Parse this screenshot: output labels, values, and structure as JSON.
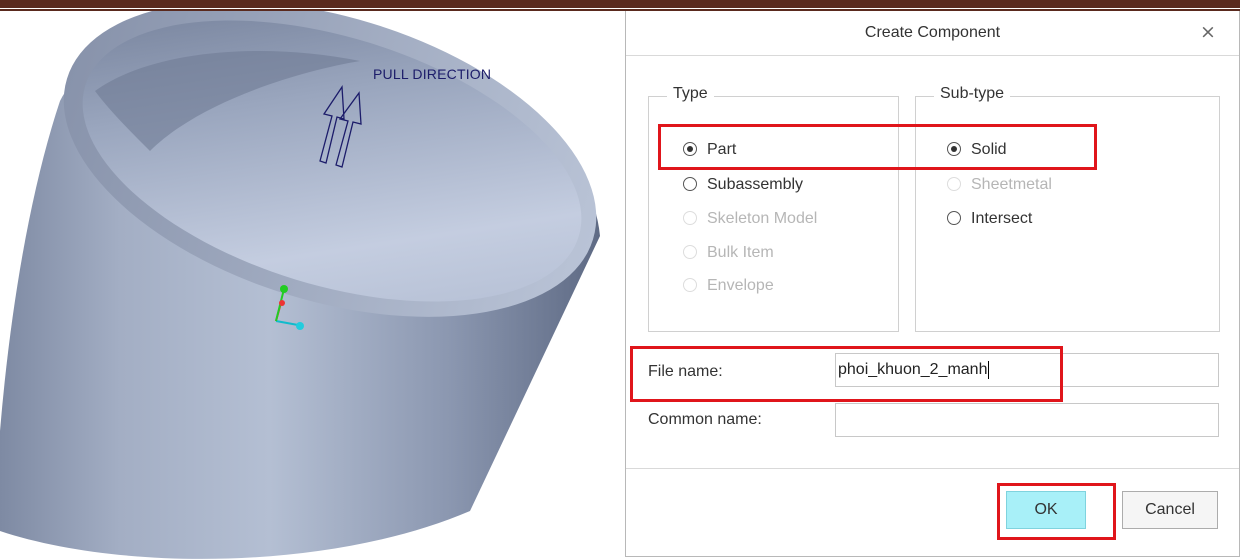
{
  "viewport": {
    "annotation": "PULL DIRECTION"
  },
  "dialog": {
    "title": "Create Component",
    "close_glyph": "×",
    "type_group": {
      "label": "Type",
      "options": [
        {
          "label": "Part",
          "selected": true,
          "enabled": true
        },
        {
          "label": "Subassembly",
          "selected": false,
          "enabled": true
        },
        {
          "label": "Skeleton Model",
          "selected": false,
          "enabled": false
        },
        {
          "label": "Bulk Item",
          "selected": false,
          "enabled": false
        },
        {
          "label": "Envelope",
          "selected": false,
          "enabled": false
        }
      ]
    },
    "subtype_group": {
      "label": "Sub-type",
      "options": [
        {
          "label": "Solid",
          "selected": true,
          "enabled": true
        },
        {
          "label": "Sheetmetal",
          "selected": false,
          "enabled": false
        },
        {
          "label": "Intersect",
          "selected": false,
          "enabled": true
        }
      ]
    },
    "file_name": {
      "label": "File name:",
      "value": "phoi_khuon_2_manh"
    },
    "common_name": {
      "label": "Common name:",
      "value": ""
    },
    "buttons": {
      "ok": "OK",
      "cancel": "Cancel"
    }
  },
  "colors": {
    "highlight": "#e0151b",
    "ok_button": "#a8f0f8",
    "model_surface": "#9aa6bd"
  }
}
